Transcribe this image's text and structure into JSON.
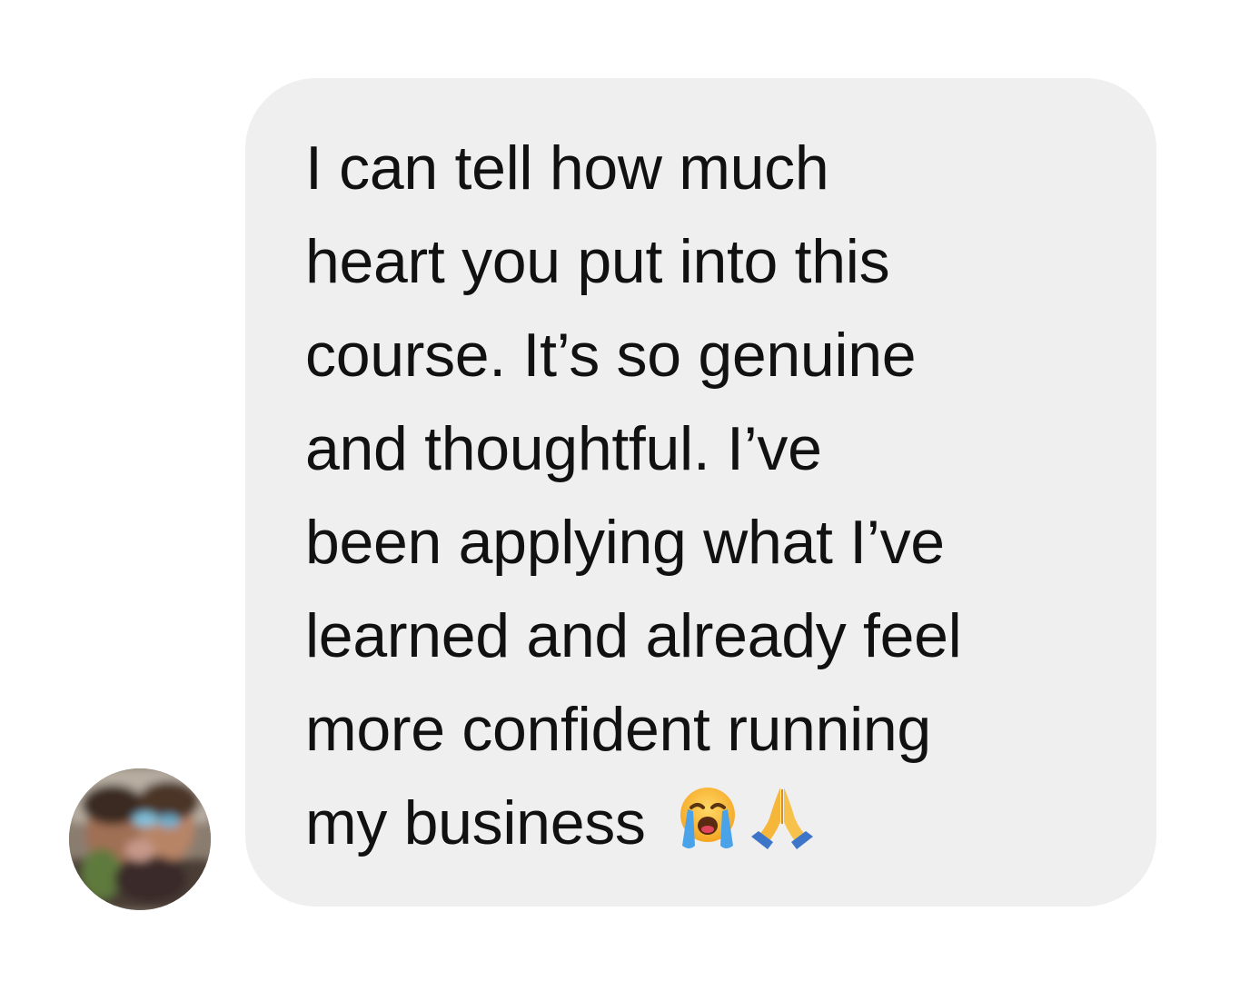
{
  "message": {
    "lines": [
      "I can tell how much",
      "heart you put into this",
      "course. It’s so genuine",
      "and thoughtful. I’ve",
      "been applying what I’ve",
      "learned and already feel",
      "more confident running",
      "my business"
    ],
    "emojis": [
      "loudly-crying-face-icon",
      "folded-hands-icon"
    ]
  },
  "colors": {
    "background": "#ffffff",
    "bubble": "#efefef",
    "text": "#111111"
  }
}
